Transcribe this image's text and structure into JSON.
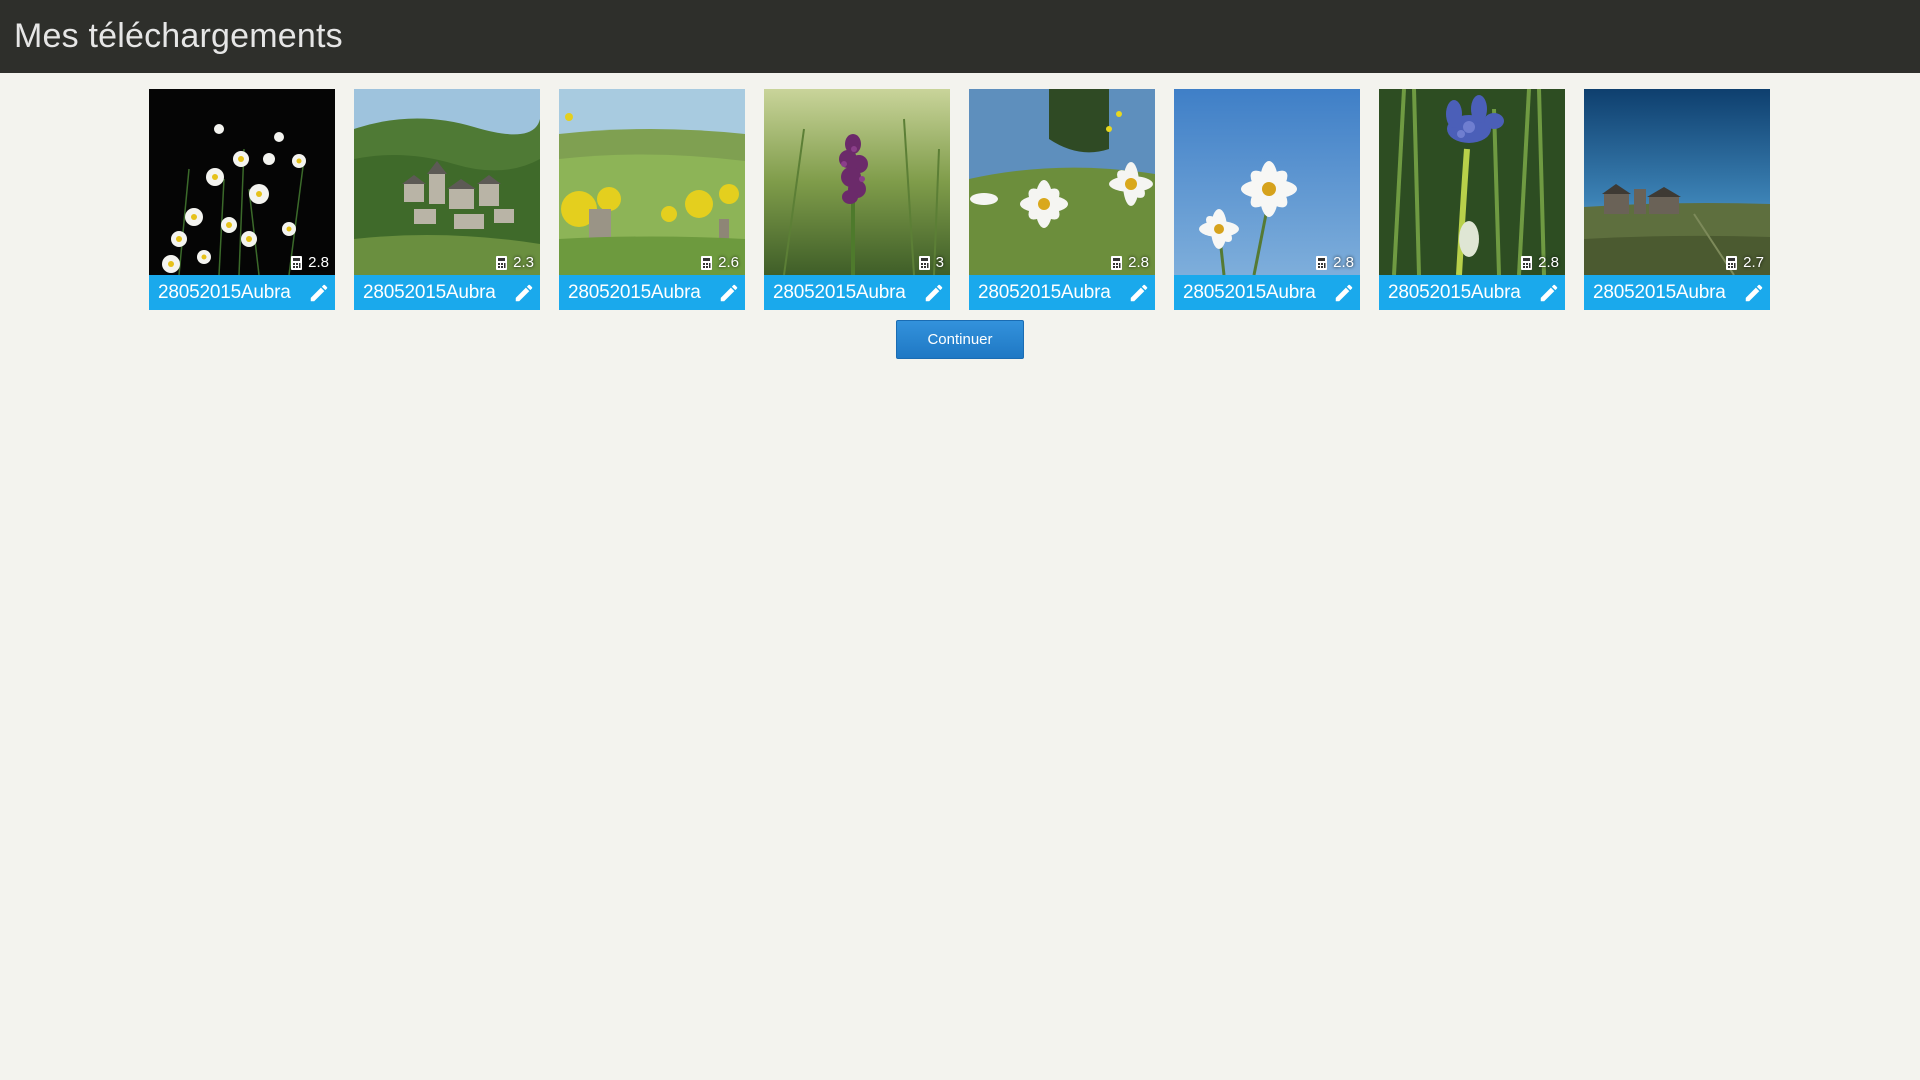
{
  "header": {
    "title": "Mes téléchargements"
  },
  "gallery": {
    "items": [
      {
        "label": "28052015Aubra",
        "rating": "2.8",
        "photo": "white daisies on black background"
      },
      {
        "label": "28052015Aubra",
        "rating": "2.3",
        "photo": "stone village in green hills"
      },
      {
        "label": "28052015Aubra",
        "rating": "2.6",
        "photo": "green meadow with yellow broom and fence post"
      },
      {
        "label": "28052015Aubra",
        "rating": "3",
        "photo": "purple orchid in grass"
      },
      {
        "label": "28052015Aubra",
        "rating": "2.8",
        "photo": "white narcissus flowers in meadow"
      },
      {
        "label": "28052015Aubra",
        "rating": "2.8",
        "photo": "white narcissus against blue sky"
      },
      {
        "label": "28052015Aubra",
        "rating": "2.8",
        "photo": "blue rampion flower among grass"
      },
      {
        "label": "28052015Aubra",
        "rating": "2.7",
        "photo": "stone farm under blue sky"
      }
    ]
  },
  "actions": {
    "continue_label": "Continuer"
  },
  "icons": {
    "rating": "calculator-icon",
    "edit": "pencil-icon"
  },
  "colors": {
    "header_bg": "#2e2f2b",
    "caption_bg": "#1aa9ec",
    "button_bg": "#2a86d2",
    "page_bg": "#f3f3ee"
  }
}
